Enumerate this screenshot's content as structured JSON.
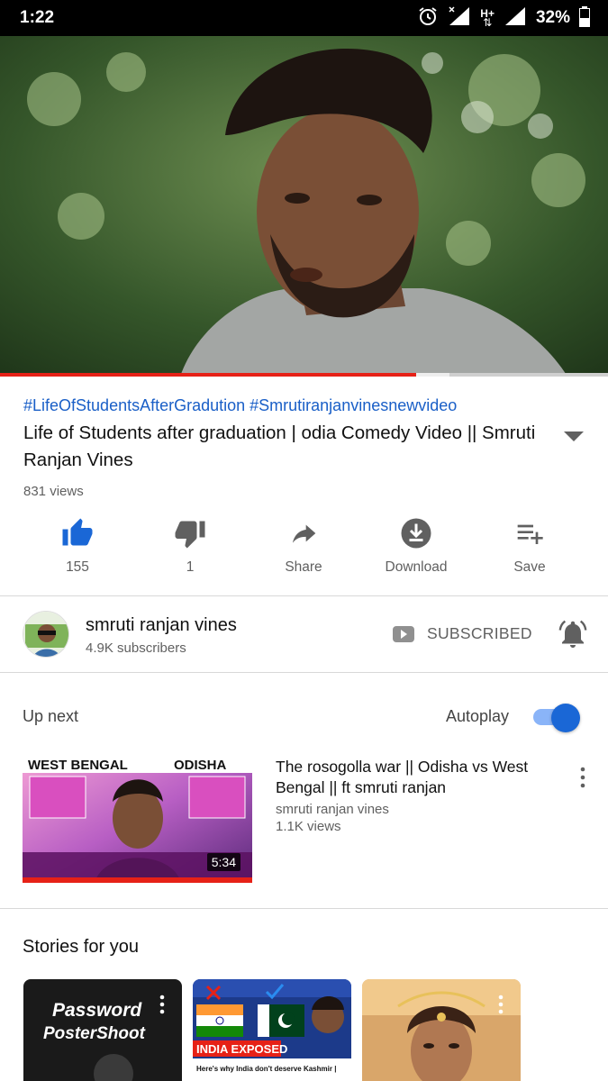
{
  "status_bar": {
    "time": "1:22",
    "battery_percent": "32%",
    "network_label": "H+"
  },
  "player": {
    "progress_fraction": 0.685,
    "buffer_fraction": 0.74
  },
  "video": {
    "hashtags": "#LifeOfStudentsAfterGradution #Smrutiranjanvinesnewvideo",
    "title": "Life of Students after graduation | odia Comedy Video || Smruti Ranjan Vines",
    "views": "831 views"
  },
  "actions": {
    "like": "155",
    "dislike": "1",
    "share": "Share",
    "download": "Download",
    "save": "Save"
  },
  "channel": {
    "name": "smruti ranjan vines",
    "subscribers": "4.9K subscribers",
    "subscribe_state": "SUBSCRIBED"
  },
  "up_next": {
    "label": "Up next",
    "autoplay_label": "Autoplay",
    "autoplay_on": true,
    "item": {
      "title": "The rosogolla war || Odisha vs West Bengal ||  ft smruti ranjan",
      "channel": "smruti ranjan vines",
      "views": "1.1K views",
      "duration": "5:34",
      "thumb_text_left": "WEST BENGAL",
      "thumb_text_right": "ODISHA"
    }
  },
  "stories": {
    "title": "Stories for you",
    "cards": [
      {
        "text_line1": "Password",
        "text_line2": "PosterShoot"
      },
      {
        "text_line1": "INDIA EXPOSED",
        "text_line2": "Here's why India don't deserve Kashmir |"
      },
      {
        "text_line1": "",
        "text_line2": ""
      }
    ]
  },
  "colors": {
    "accent_blue": "#1a67d6",
    "hashtag_blue": "#1a5fc7",
    "progress_red": "#e62117"
  }
}
